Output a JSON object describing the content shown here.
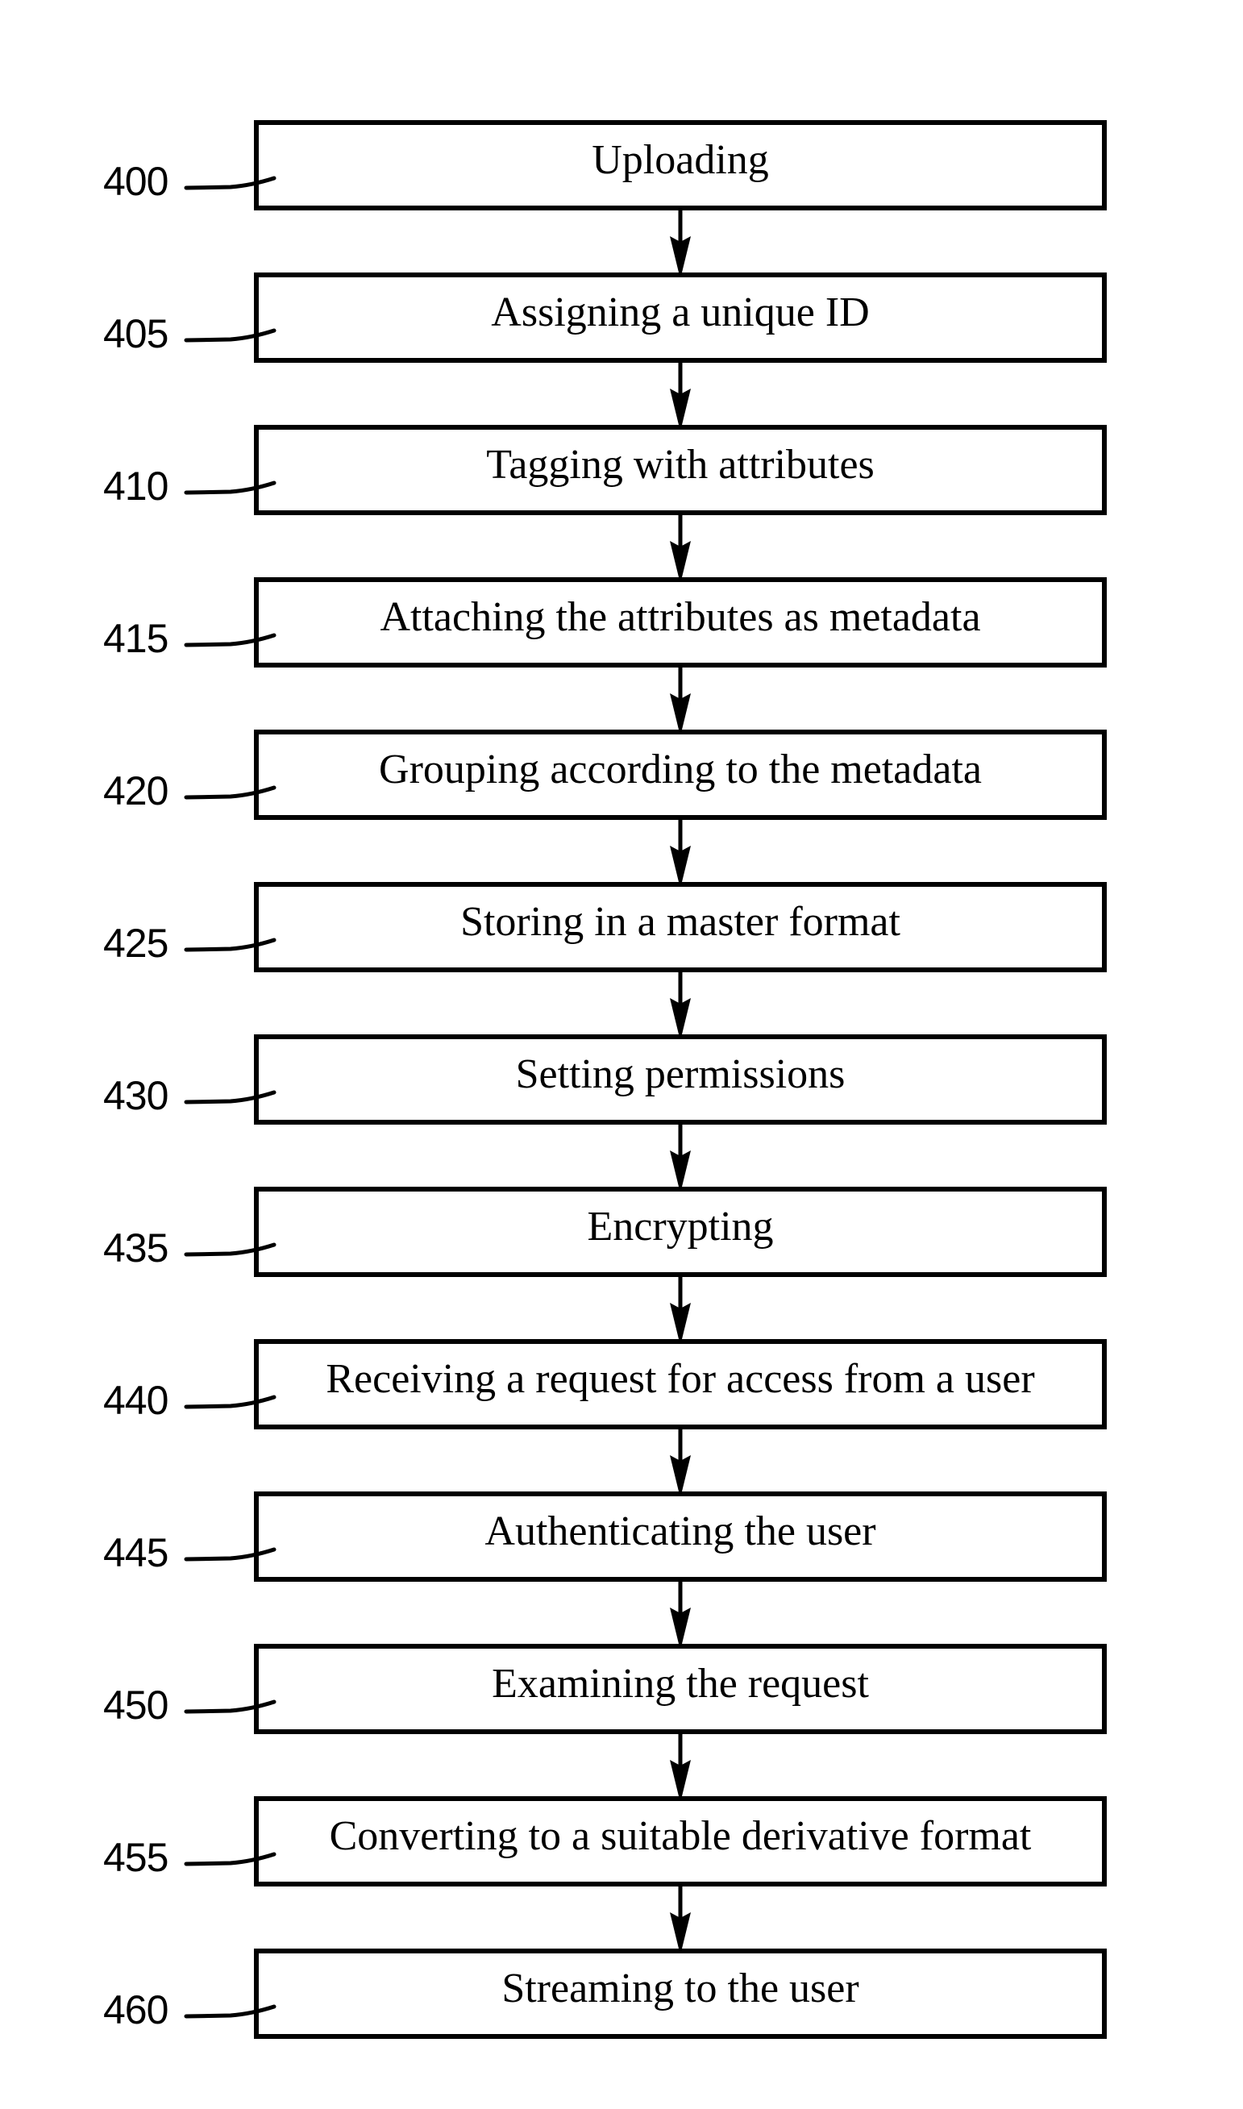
{
  "figure": {
    "line_color": "#000000",
    "background_color": "#ffffff",
    "steps": [
      {
        "ref": "400",
        "label": "Uploading"
      },
      {
        "ref": "405",
        "label": "Assigning a unique ID"
      },
      {
        "ref": "410",
        "label": "Tagging with attributes"
      },
      {
        "ref": "415",
        "label": "Attaching the attributes as metadata"
      },
      {
        "ref": "420",
        "label": "Grouping according to the metadata"
      },
      {
        "ref": "425",
        "label": "Storing in a master format"
      },
      {
        "ref": "430",
        "label": "Setting permissions"
      },
      {
        "ref": "435",
        "label": "Encrypting"
      },
      {
        "ref": "440",
        "label": "Receiving a request for access from a user"
      },
      {
        "ref": "445",
        "label": "Authenticating the user"
      },
      {
        "ref": "450",
        "label": "Examining the request"
      },
      {
        "ref": "455",
        "label": "Converting to a suitable derivative format"
      },
      {
        "ref": "460",
        "label": "Streaming to the user"
      }
    ]
  }
}
